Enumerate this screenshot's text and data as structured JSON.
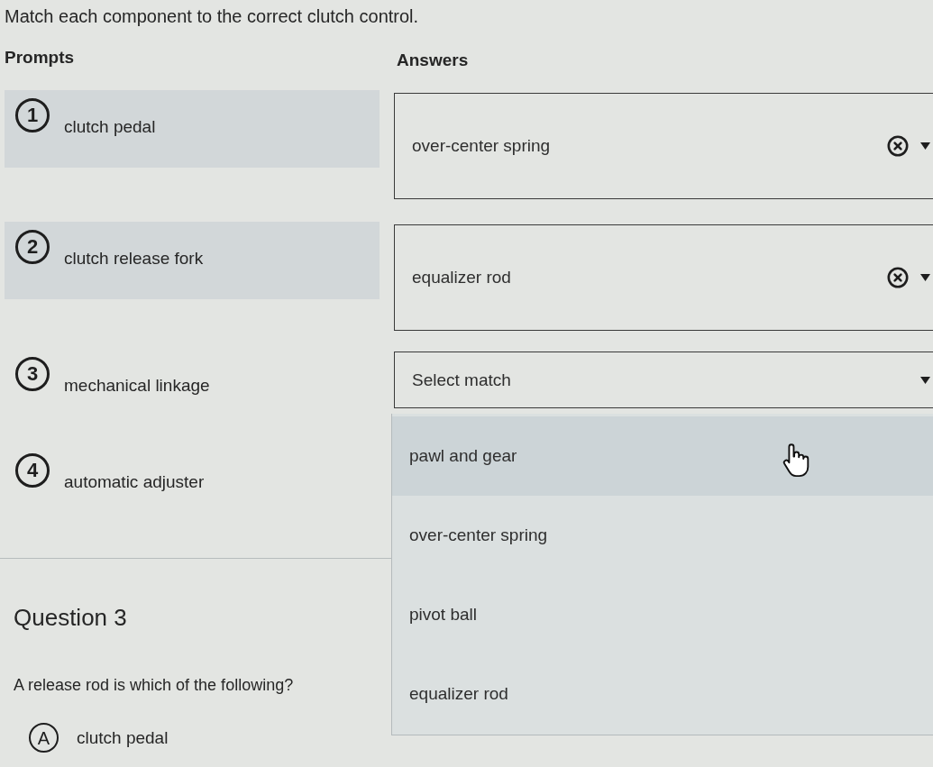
{
  "instruction": "Match each component to the correct clutch control.",
  "headers": {
    "prompts": "Prompts",
    "answers": "Answers"
  },
  "rows": [
    {
      "number": "1",
      "prompt": "clutch pedal",
      "matched": true,
      "answer": {
        "value": "over-center spring"
      }
    },
    {
      "number": "2",
      "prompt": "clutch release fork",
      "matched": true,
      "answer": {
        "value": "equalizer rod"
      }
    },
    {
      "number": "3",
      "prompt": "mechanical linkage",
      "matched": false,
      "answer": {
        "placeholder": "Select match",
        "expanded": true,
        "options": [
          {
            "label": "pawl and gear",
            "highlighted": true
          },
          {
            "label": "over-center spring",
            "highlighted": false
          },
          {
            "label": "pivot ball",
            "highlighted": false
          },
          {
            "label": "equalizer rod",
            "highlighted": false
          }
        ]
      }
    },
    {
      "number": "4",
      "prompt": "automatic adjuster",
      "matched": false
    }
  ],
  "question": {
    "title": "Question 3",
    "text": "A release rod is which of the following?",
    "choices": [
      {
        "letter": "A",
        "label": "clutch pedal"
      }
    ]
  }
}
